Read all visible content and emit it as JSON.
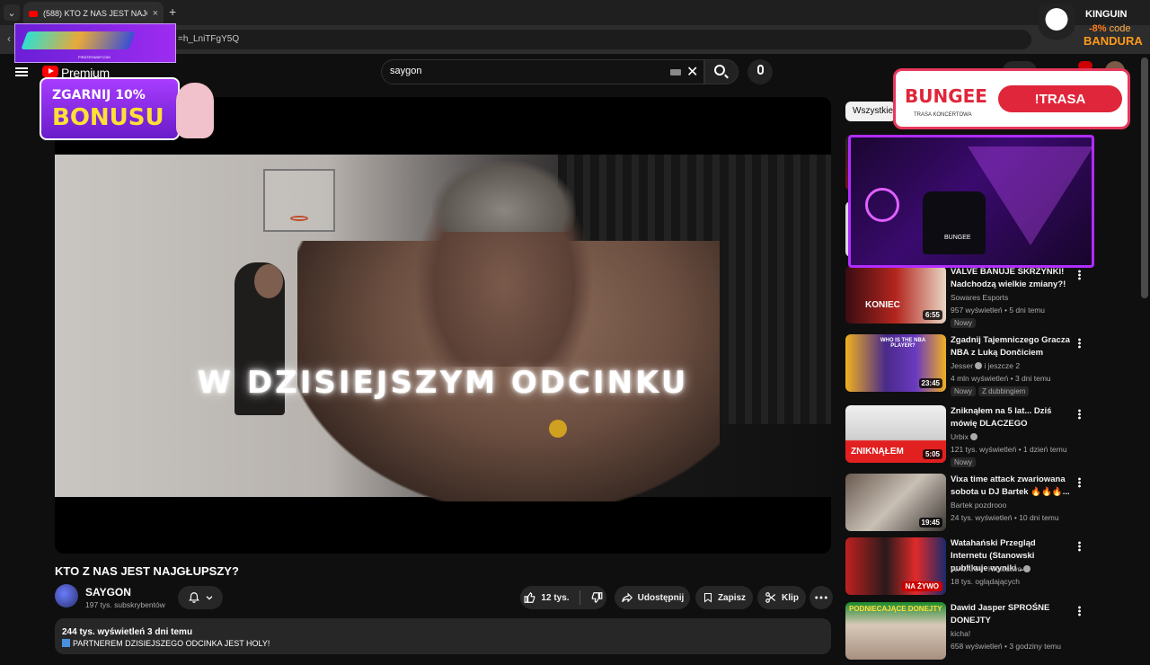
{
  "browser": {
    "tab_title": "(588) KTO Z NAS JEST NAJGŁUPSZY?",
    "tab_close": "×",
    "new_tab": "+",
    "url_fragment": "=h_LniTFgY5Q"
  },
  "ads": {
    "pirates_label": "PIRATESWAP.COM",
    "bonus_line1": "ZGARNIJ 10%",
    "bonus_line2": "BONUSU",
    "kinguin_logo": "KINGUIN",
    "kinguin_discount": "-8%",
    "kinguin_code_label": "code",
    "kinguin_code": "BANDURA",
    "bungee_logo": "BUNGEE",
    "bungee_sub": "TRASA KONCERTOWA",
    "bungee_cta": "!TRASA",
    "stream_name": "BUNGEE"
  },
  "header": {
    "brand": "Premium",
    "search_value": "saygon"
  },
  "player": {
    "caption": "W DZISIEJSZYM ODCINKU"
  },
  "video": {
    "title": "KTO Z NAS JEST NAJGŁUPSZY?",
    "channel": "SAYGON",
    "subscribers": "197 tys. subskrybentów",
    "likes": "12 tys.",
    "share": "Udostępnij",
    "save": "Zapisz",
    "clip": "Klip",
    "views_date": "244 tys. wyświetleń  3 dni temu",
    "desc_line": "PARTNEREM DZISIEJSZEGO ODCINKA JEST HOLY!"
  },
  "sidebar": {
    "chip": "Wszystkie",
    "items": [
      {
        "title": "VALVE BANUJE SKRZYNKI! Nadchodzą wielkie zmiany?!",
        "channel": "Sowares Esports",
        "meta": "957 wyświetleń • 5 dni temu",
        "badge": "Nowy",
        "duration": "6:55",
        "thumb": "KONIEC"
      },
      {
        "title": "Zgadnij Tajemniczego Gracza NBA z Luką Dončiciem",
        "channel": "Jesser",
        "channel_extra": "i jeszcze 2",
        "meta": "4 mln wyświetleń • 3 dni temu",
        "badge": "Nowy",
        "badge2": "Z dubbingiem",
        "duration": "23:45",
        "thumb": "WHO IS THE NBA PLAYER?"
      },
      {
        "title": "Zniknąłem na 5 lat... Dziś mówię DLACZEGO",
        "channel": "Urbix",
        "meta": "121 tys. wyświetleń • 1 dzień temu",
        "badge": "Nowy",
        "duration": "5:05",
        "thumb": "ZNIKNĄŁEM"
      },
      {
        "title": "Vixa time attack zwariowana sobota u DJ Bartek 🔥🔥🔥...",
        "channel": "Bartek pozdrooo",
        "meta": "24 tys. wyświetleń • 10 dni temu",
        "duration": "19:45"
      },
      {
        "title": "Watahański Przegląd Internetu (Stanowski publikuje wyniki ...",
        "channel": "WATAHA - Krulestwo",
        "meta": "18 tys. oglądających",
        "live": "NA ŻYWO"
      },
      {
        "title": "Dawid Jasper SPROŚNE DONEJTY",
        "channel": "kicha!",
        "meta": "658 wyświetleń • 3 godziny temu",
        "thumb": "PODNIECAJĄCE DONEJTY"
      }
    ]
  },
  "colors": {
    "accent": "#ff0000",
    "bg": "#0f0f0f",
    "pill": "#272727",
    "live": "#cc0000"
  },
  "icons": [
    "menu-icon",
    "youtube-logo-icon",
    "keyboard-icon",
    "clear-icon",
    "search-icon",
    "mic-icon",
    "bell-icon",
    "chevron-down-icon",
    "thumb-up-icon",
    "thumb-down-icon",
    "share-icon",
    "save-icon",
    "clip-icon",
    "more-icon",
    "kebab-icon",
    "verified-icon"
  ]
}
